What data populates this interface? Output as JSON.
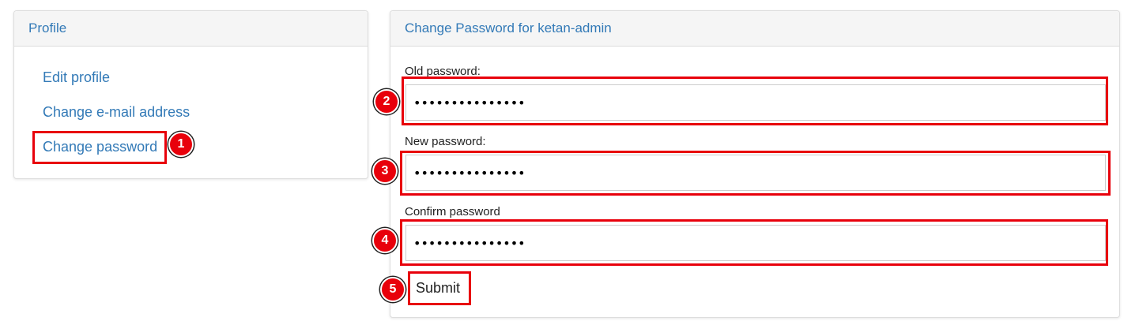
{
  "profile": {
    "title": "Profile",
    "links": [
      {
        "label": "Edit profile"
      },
      {
        "label": "Change e-mail address"
      },
      {
        "label": "Change password"
      }
    ]
  },
  "change_password": {
    "title": "Change Password for ketan-admin",
    "old_password": {
      "label": "Old password:",
      "value": "•••••••••••••••"
    },
    "new_password": {
      "label": "New password:",
      "value": "•••••••••••••••"
    },
    "confirm_password": {
      "label": "Confirm password",
      "value": "•••••••••••••••"
    },
    "submit_label": "Submit"
  },
  "annotations": {
    "highlight_color": "#e8000b",
    "markers": [
      "1",
      "2",
      "3",
      "4",
      "5"
    ]
  }
}
